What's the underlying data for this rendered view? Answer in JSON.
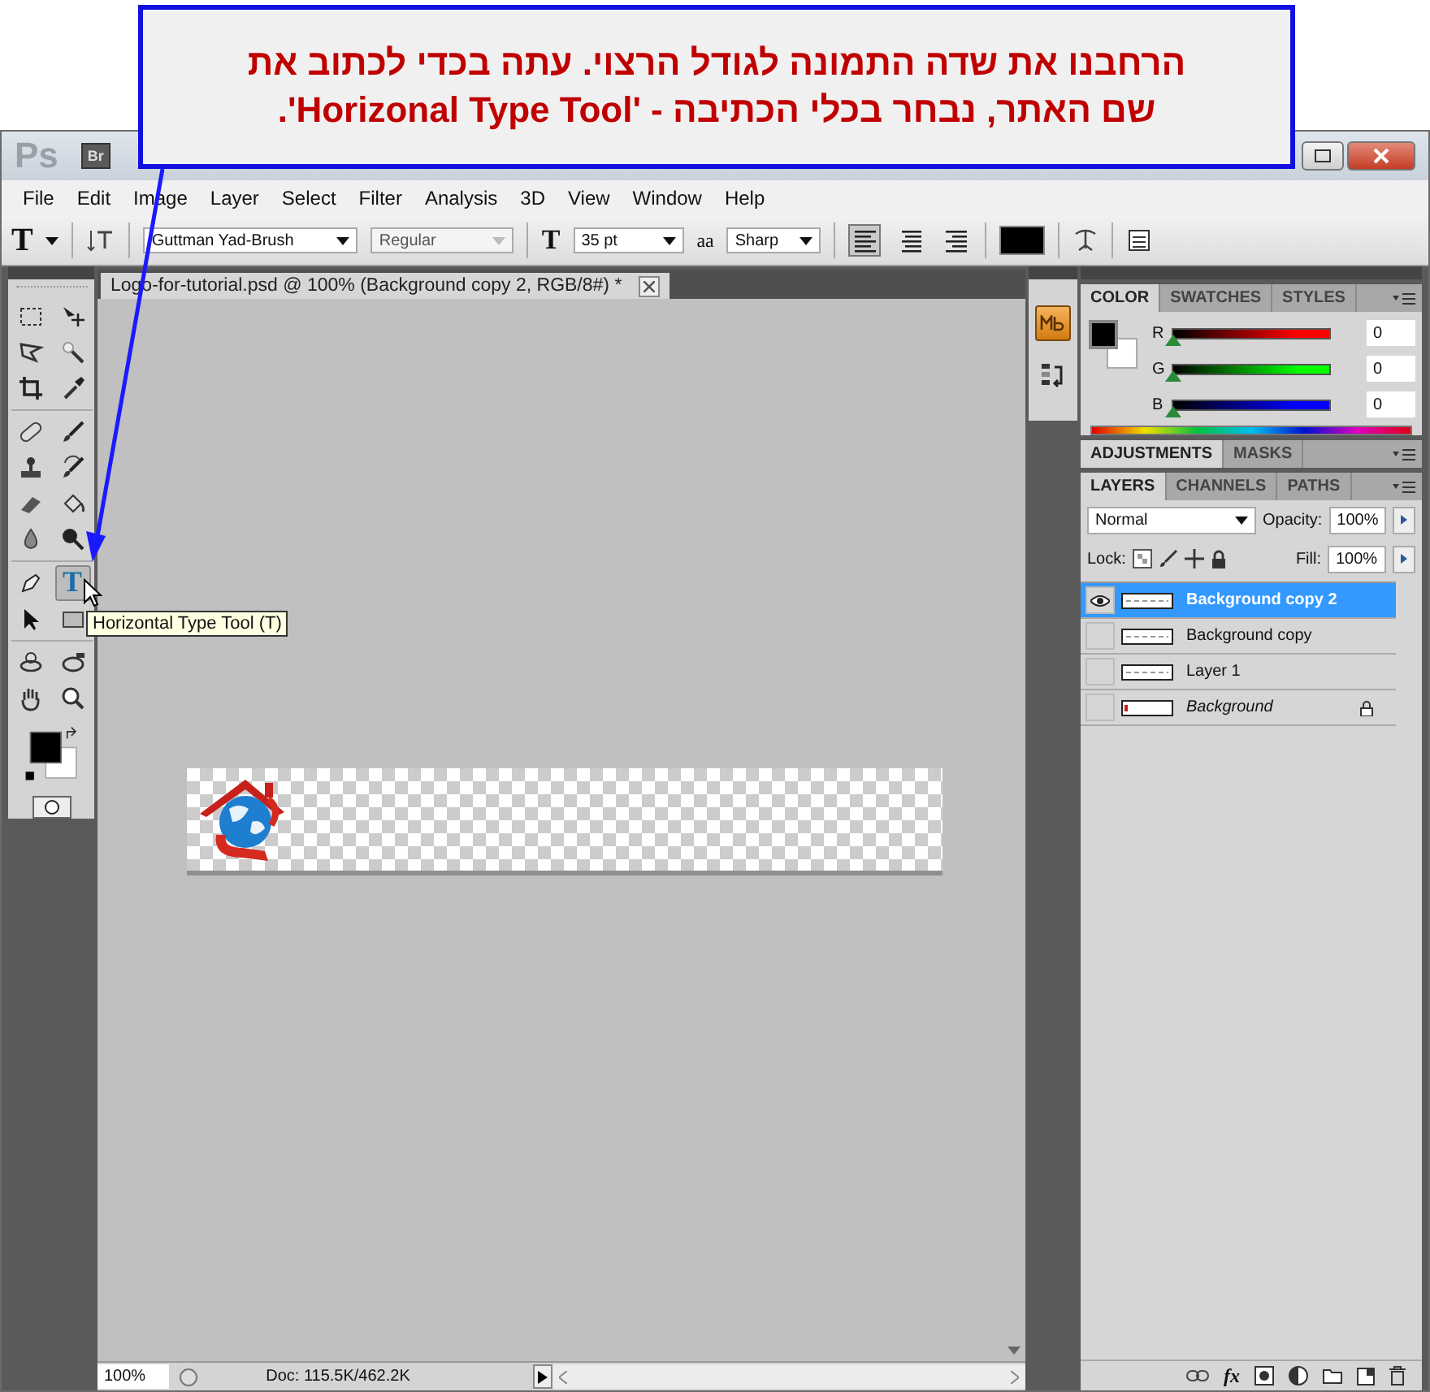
{
  "callout": {
    "text": "הרחבנו את שדה התמונה לגודל הרצוי. עתה בכדי לכתוב את שם האתר, נבחר בכלי הכתיבה - 'Horizonal Type Tool'."
  },
  "title_bar": {
    "logo": "Ps",
    "bridge": "Br"
  },
  "menu": [
    "File",
    "Edit",
    "Image",
    "Layer",
    "Select",
    "Filter",
    "Analysis",
    "3D",
    "View",
    "Window",
    "Help"
  ],
  "options_bar": {
    "tool_glyph": "T",
    "font_family": "Guttman Yad-Brush",
    "font_style": {
      "value": "Regular",
      "disabled": true
    },
    "size_glyph": "T",
    "size": "35 pt",
    "aa_glyph": "aa",
    "antialias": "Sharp",
    "alignment": [
      {
        "selected": true
      },
      {
        "selected": false
      },
      {
        "selected": false
      }
    ]
  },
  "tools": [
    {
      "kind": "marquee",
      "selected": false
    },
    {
      "kind": "move",
      "selected": false
    },
    {
      "kind": "lasso",
      "selected": false
    },
    {
      "kind": "wand",
      "selected": false
    },
    {
      "kind": "crop",
      "selected": false
    },
    {
      "kind": "eyedropper",
      "selected": false
    },
    {
      "kind": "healing",
      "selected": false
    },
    {
      "kind": "brush",
      "selected": false
    },
    {
      "kind": "stamp",
      "selected": false
    },
    {
      "kind": "history",
      "selected": false
    },
    {
      "kind": "eraser",
      "selected": false
    },
    {
      "kind": "bucket",
      "selected": false
    },
    {
      "kind": "blur",
      "selected": false
    },
    {
      "kind": "dodge",
      "selected": false
    },
    {
      "kind": "pen",
      "selected": false
    },
    {
      "kind": "type",
      "selected": true,
      "glyph": "T"
    },
    {
      "kind": "path",
      "selected": false
    },
    {
      "kind": "shape",
      "selected": false
    },
    {
      "kind": "rotate3d",
      "selected": false
    },
    {
      "kind": "orbit3d",
      "selected": false
    },
    {
      "kind": "hand",
      "selected": false
    },
    {
      "kind": "zoom",
      "selected": false
    }
  ],
  "tooltip": "Horizontal Type Tool (T)",
  "document": {
    "tab_title": "Logo-for-tutorial.psd @ 100% (Background copy 2, RGB/8#) *",
    "zoom": "100%",
    "status": "Doc: 115.5K/462.2K"
  },
  "color_panel": {
    "tabs": [
      {
        "label": "COLOR",
        "selected": true
      },
      {
        "label": "SWATCHES",
        "selected": false
      },
      {
        "label": "STYLES",
        "selected": false
      }
    ],
    "channels": [
      {
        "label": "R",
        "value": "0",
        "level": 0,
        "color": "#ff0000"
      },
      {
        "label": "G",
        "value": "0",
        "level": 0,
        "color": "#00ff00"
      },
      {
        "label": "B",
        "value": "0",
        "level": 0,
        "color": "#0000ff"
      }
    ]
  },
  "adjustments_panel": {
    "tabs": [
      {
        "label": "ADJUSTMENTS",
        "selected": true
      },
      {
        "label": "MASKS",
        "selected": false
      }
    ]
  },
  "layers_panel": {
    "tabs": [
      {
        "label": "LAYERS",
        "selected": true
      },
      {
        "label": "CHANNELS",
        "selected": false
      },
      {
        "label": "PATHS",
        "selected": false
      }
    ],
    "blend_mode": "Normal",
    "opacity_label": "Opacity:",
    "opacity": "100%",
    "lock_label": "Lock:",
    "fill_label": "Fill:",
    "fill": "100%",
    "items": [
      {
        "name": "Background copy 2",
        "visible": true,
        "selected": true,
        "kind": "layer",
        "locked": false
      },
      {
        "name": "Background copy",
        "visible": false,
        "selected": false,
        "kind": "layer",
        "locked": false
      },
      {
        "name": "Layer 1",
        "visible": false,
        "selected": false,
        "kind": "layer",
        "locked": false
      },
      {
        "name": "Background",
        "visible": false,
        "selected": false,
        "kind": "background",
        "locked": true
      }
    ],
    "fx_glyph": "fx"
  }
}
